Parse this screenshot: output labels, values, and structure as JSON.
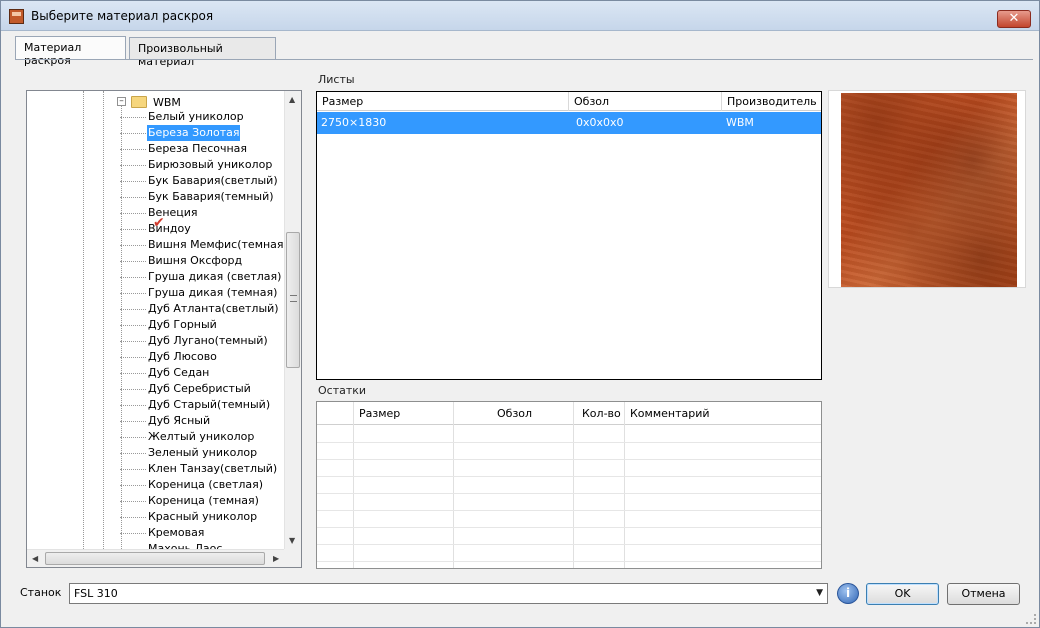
{
  "window": {
    "title": "Выберите материал раскроя",
    "close_label": "✕"
  },
  "tabs": [
    {
      "label": "Материал раскроя",
      "active": true
    },
    {
      "label": "Произвольный материал",
      "active": false
    }
  ],
  "tree": {
    "folder": "WBM",
    "items": [
      "Белый уникoлор",
      "Береза Золотая",
      "Береза Песочная",
      "Бирюзовый уникoлор",
      "Бук Бавария(светлый)",
      "Бук Бавария(темный)",
      "Венеция",
      "Виндоу",
      "Вишня Мемфис(темная)",
      "Вишня Оксфорд",
      "Груша дикая (светлая)",
      "Груша дикая (темная)",
      "Дуб Атланта(светлый)",
      "Дуб Горный",
      "Дуб Лугано(темный)",
      "Дуб Люсово",
      "Дуб Седан",
      "Дуб Серебристый",
      "Дуб Старый(темный)",
      "Дуб Ясный",
      "Желтый уникoлор",
      "Зеленый уникoлор",
      "Клен Танзау(светлый)",
      "Кореница (светлая)",
      "Кореница (темная)",
      "Красный уникoлор",
      "Кремовая",
      "Махонь Лаос"
    ],
    "selected_index": 1
  },
  "sheets": {
    "label": "Листы",
    "columns": [
      "Размер",
      "Обзол",
      "Производитель"
    ],
    "rows": [
      {
        "size": "2750×1830",
        "edge": "0x0x0x0",
        "manufacturer": "WBM"
      }
    ]
  },
  "remnants": {
    "label": "Остатки",
    "columns": [
      "Размер",
      "Обзол",
      "Кол-во",
      "Комментарий"
    ]
  },
  "footer": {
    "machine_label": "Станок",
    "machine_value": "FSL 310",
    "info_label": "i",
    "ok_label": "OK",
    "cancel_label": "Отмена"
  },
  "colors": {
    "selection": "#3399ff",
    "wood": "#c6582a"
  }
}
